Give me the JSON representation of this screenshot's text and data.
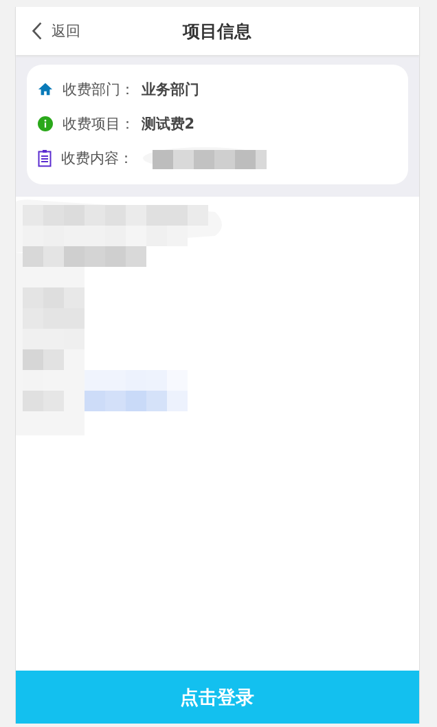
{
  "header": {
    "back_label": "返回",
    "title": "项目信息"
  },
  "info_rows": [
    {
      "kind": "department",
      "label": "收费部门：",
      "value": "业务部门"
    },
    {
      "kind": "item",
      "label": "收费项目：",
      "value": "测试费2"
    },
    {
      "kind": "content",
      "label": "收费内容："
    }
  ],
  "login_button": {
    "label": "点击登录"
  }
}
